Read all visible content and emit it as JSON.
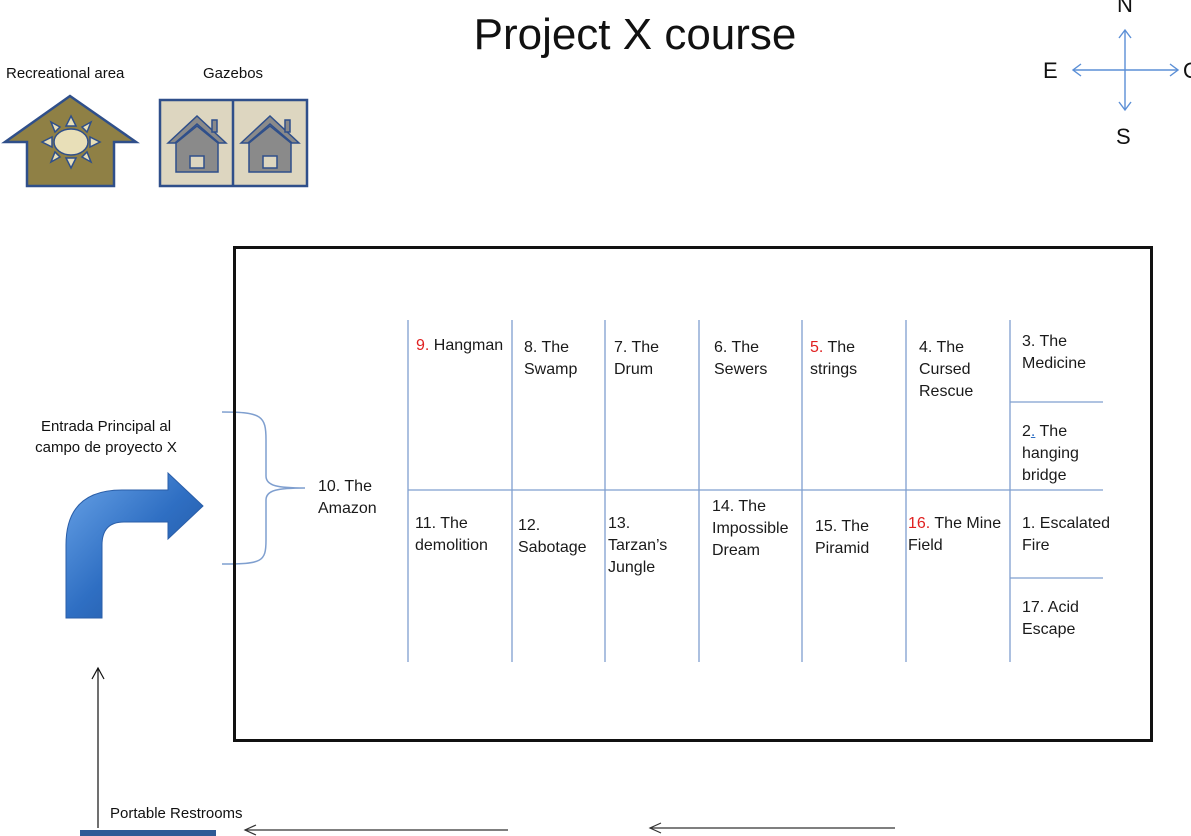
{
  "title": "Project X course",
  "legend": {
    "recreational_label": "Recreational area",
    "gazebos_label": "Gazebos"
  },
  "compass": {
    "n": "N",
    "e": "E",
    "s": "S",
    "w": "O"
  },
  "entrance": {
    "line1": "Entrada Principal al",
    "line2": "campo  de proyecto X"
  },
  "restrooms_label": "Portable Restrooms",
  "stations": {
    "s10": {
      "line1": "10. The",
      "line2": "Amazon"
    },
    "s9": {
      "num": "9.",
      "name": "Hangman"
    },
    "s8": {
      "line1": "8. The",
      "line2": "Swamp"
    },
    "s7": {
      "line1": "7. The",
      "line2": "Drum"
    },
    "s6": {
      "line1": "6. The",
      "line2": "Sewers"
    },
    "s5": {
      "num": "5.",
      "name": " The",
      "line2": "strings"
    },
    "s4": {
      "line1": "4. The",
      "line2": "Cursed",
      "line3": "Rescue"
    },
    "s3": {
      "line1": "3. The",
      "line2": "Medicine"
    },
    "s2": {
      "num": "2",
      "dot": ".",
      "name": " The",
      "line2": "hanging",
      "line3": "bridge"
    },
    "s11": {
      "line1": "11. The",
      "line2": "demolition"
    },
    "s12": {
      "line1": "12.",
      "line2": "Sabotage"
    },
    "s13": {
      "line1": "13.",
      "line2": "Tarzan’s",
      "line3": "Jungle"
    },
    "s14": {
      "line1": "14. The",
      "line2": "Impossible",
      "line3": "Dream"
    },
    "s15": {
      "line1": "15. The",
      "line2": "Piramid"
    },
    "s16": {
      "num": "16.",
      "name": " The Mine",
      "line2": "Field"
    },
    "s1": {
      "line1": "1. Escalated",
      "line2": "Fire"
    },
    "s17": {
      "line1": "17. Acid",
      "line2": "Escape"
    }
  },
  "colors": {
    "grid_line": "#7f9fcf",
    "red_number": "#e02020",
    "recreational_fill": "#8f8045",
    "icon_stroke": "#2f4f8a",
    "gazebo_fill": "#ddd6c0",
    "arrow_blue": "#2f6fc3"
  }
}
